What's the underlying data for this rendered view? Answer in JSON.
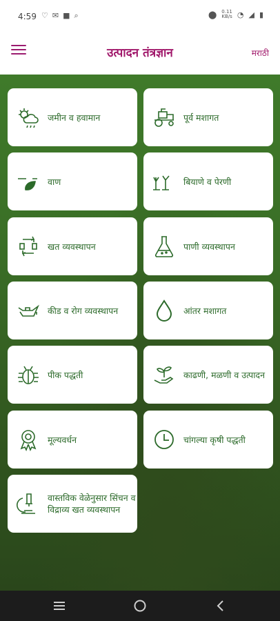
{
  "status_bar": {
    "time": "4:59",
    "net_speed_value": "0.11",
    "net_speed_unit": "KB/s"
  },
  "app_bar": {
    "title": "उत्पादन तंत्रज्ञान",
    "language": "मराठी"
  },
  "tiles": [
    {
      "label": "जमीन व हवामान",
      "icon": "weather-icon"
    },
    {
      "label": "पूर्व मशागत",
      "icon": "tractor-icon"
    },
    {
      "label": "वाण",
      "icon": "seed-variety-icon"
    },
    {
      "label": "बियाणे व पेरणी",
      "icon": "sowing-icon"
    },
    {
      "label": "खत व्यवस्थापन",
      "icon": "recycle-icon"
    },
    {
      "label": "पाणी व्यवस्थापन",
      "icon": "flask-icon"
    },
    {
      "label": "कीड व रोग व्यवस्थापन",
      "icon": "oil-can-icon"
    },
    {
      "label": "आंतर मशागत",
      "icon": "water-drop-icon"
    },
    {
      "label": "पीक पद्धती",
      "icon": "bug-icon"
    },
    {
      "label": "काढणी, मळणी व उत्पादन",
      "icon": "sprout-hand-icon"
    },
    {
      "label": "मूल्यवर्धन",
      "icon": "award-icon"
    },
    {
      "label": "चांगल्या कृषी पद्धती",
      "icon": "clock-icon"
    },
    {
      "label": "वास्तविक वेळेनुसार सिंचन व विद्राव्य खत व्यवस्थापन",
      "icon": "microscope-icon"
    }
  ],
  "colors": {
    "accent": "#a0176a",
    "tile_text": "#2c6a2a",
    "background": "#3a6e26"
  }
}
